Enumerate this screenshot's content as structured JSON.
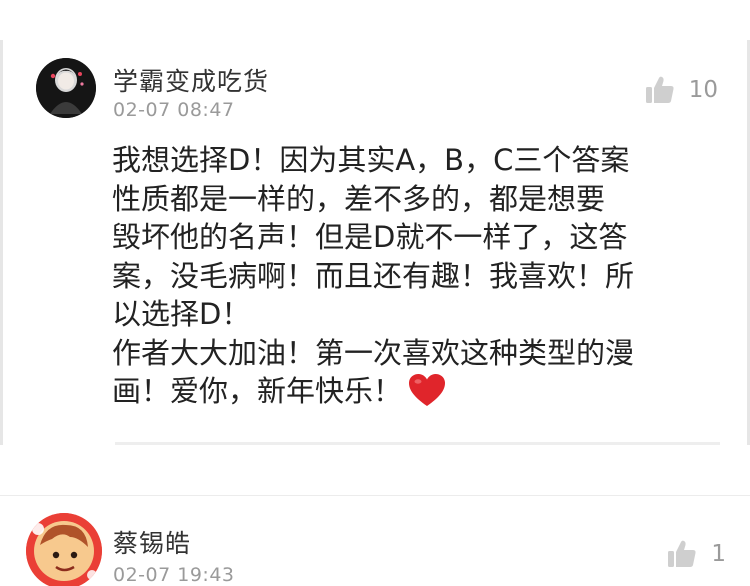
{
  "comments": [
    {
      "username": "学霸变成吃货",
      "timestamp": "02-07 08:47",
      "likes": "10",
      "body_lines": [
        "我想选择D！因为其实A，B，C三个答案",
        "性质都是一样的，差不多的，都是想要",
        "毁坏他的名声！但是D就不一样了，这答",
        "案，没毛病啊！而且还有趣！我喜欢！所",
        "以选择D！",
        "作者大大加油！第一次喜欢这种类型的漫",
        "画！爱你，新年快乐！"
      ],
      "emoji": "heart-icon"
    },
    {
      "username": "蔡锡皓",
      "timestamp": "02-07 19:43",
      "likes": "1"
    }
  ],
  "colors": {
    "heart": "#e0252b",
    "username": "#333333",
    "meta": "#9a9a9a",
    "text": "#222222"
  }
}
